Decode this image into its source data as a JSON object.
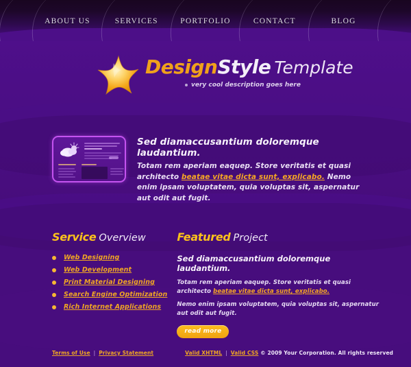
{
  "nav": {
    "items": [
      {
        "label": "ABOUT US",
        "name": "nav-item-about-us"
      },
      {
        "label": "SERVICES",
        "name": "nav-item-services"
      },
      {
        "label": "PORTFOLIO",
        "name": "nav-item-portfolio"
      },
      {
        "label": "CONTACT",
        "name": "nav-item-contact"
      },
      {
        "label": "BLOG",
        "name": "nav-item-blog"
      }
    ]
  },
  "logo": {
    "icon": "star-icon",
    "word1": "Design",
    "word2": "Style",
    "word3": "Template",
    "tagline": "very cool description goes here"
  },
  "intro": {
    "thumbnail_icon": "website-preview-thumbnail",
    "heading": "Sed diamaccusantium doloremque laudantium.",
    "body_part1": "Totam rem aperiam eaquep. Store veritatis et quasi architecto ",
    "body_link": "beatae vitae dicta sunt, explicabo.",
    "body_part2": " Nemo enim ipsam voluptatem, quia voluptas sit, aspernatur aut odit aut fugit."
  },
  "service_overview": {
    "heading_bold": "Service",
    "heading_light": "Overview",
    "items": [
      "Web Designing",
      "Web Development",
      "Print Material Designing",
      "Search Engine Optimization",
      "Rich Internet Applications"
    ]
  },
  "featured_project": {
    "heading_bold": "Featured",
    "heading_light": "Project",
    "subheading": "Sed diamaccusantium doloremque laudantium.",
    "para1_part1": "Totam rem aperiam eaquep. Store veritatis et quasi architecto ",
    "para1_link": "beatae vitae dicta sunt, explicabo.",
    "para2": "Nemo enim ipsam voluptatem, quia voluptas sit, aspernatur aut odit aut fugit.",
    "button_label": "read more"
  },
  "footer": {
    "terms_label": "Terms of Use",
    "sep1": "|",
    "privacy_label": "Privacy Statement",
    "xhtml_label": "Valid XHTML",
    "sep2": "|",
    "css_label": "Valid CSS",
    "copyright": "© 2009 Your Corporation. All rights reserved"
  },
  "colors": {
    "accent_orange": "#f0a623",
    "heading_yellow": "#fcc21b",
    "background_purple": "#480d7d",
    "header_dark": "#190620",
    "thumb_border": "#c553f0"
  }
}
